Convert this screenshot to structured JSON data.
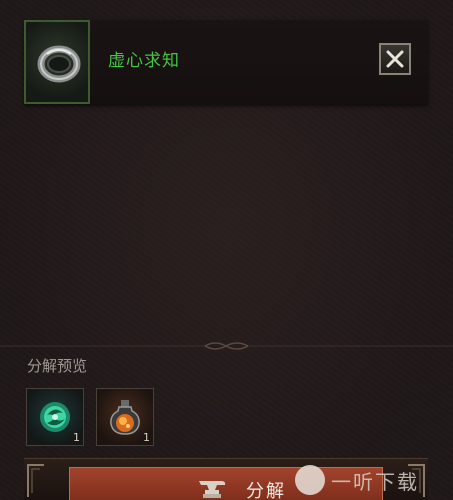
{
  "item": {
    "name": "虚心求知",
    "icon": "ring-icon"
  },
  "preview": {
    "label": "分解预览",
    "materials": [
      {
        "icon": "green-essence-icon",
        "count": "1"
      },
      {
        "icon": "fire-potion-icon",
        "count": "1"
      }
    ]
  },
  "action": {
    "disassemble_label": "分解",
    "icon": "anvil-icon"
  },
  "watermark": {
    "text": "一听下载"
  },
  "colors": {
    "item_name": "#45c545",
    "button": "#a2432c"
  }
}
